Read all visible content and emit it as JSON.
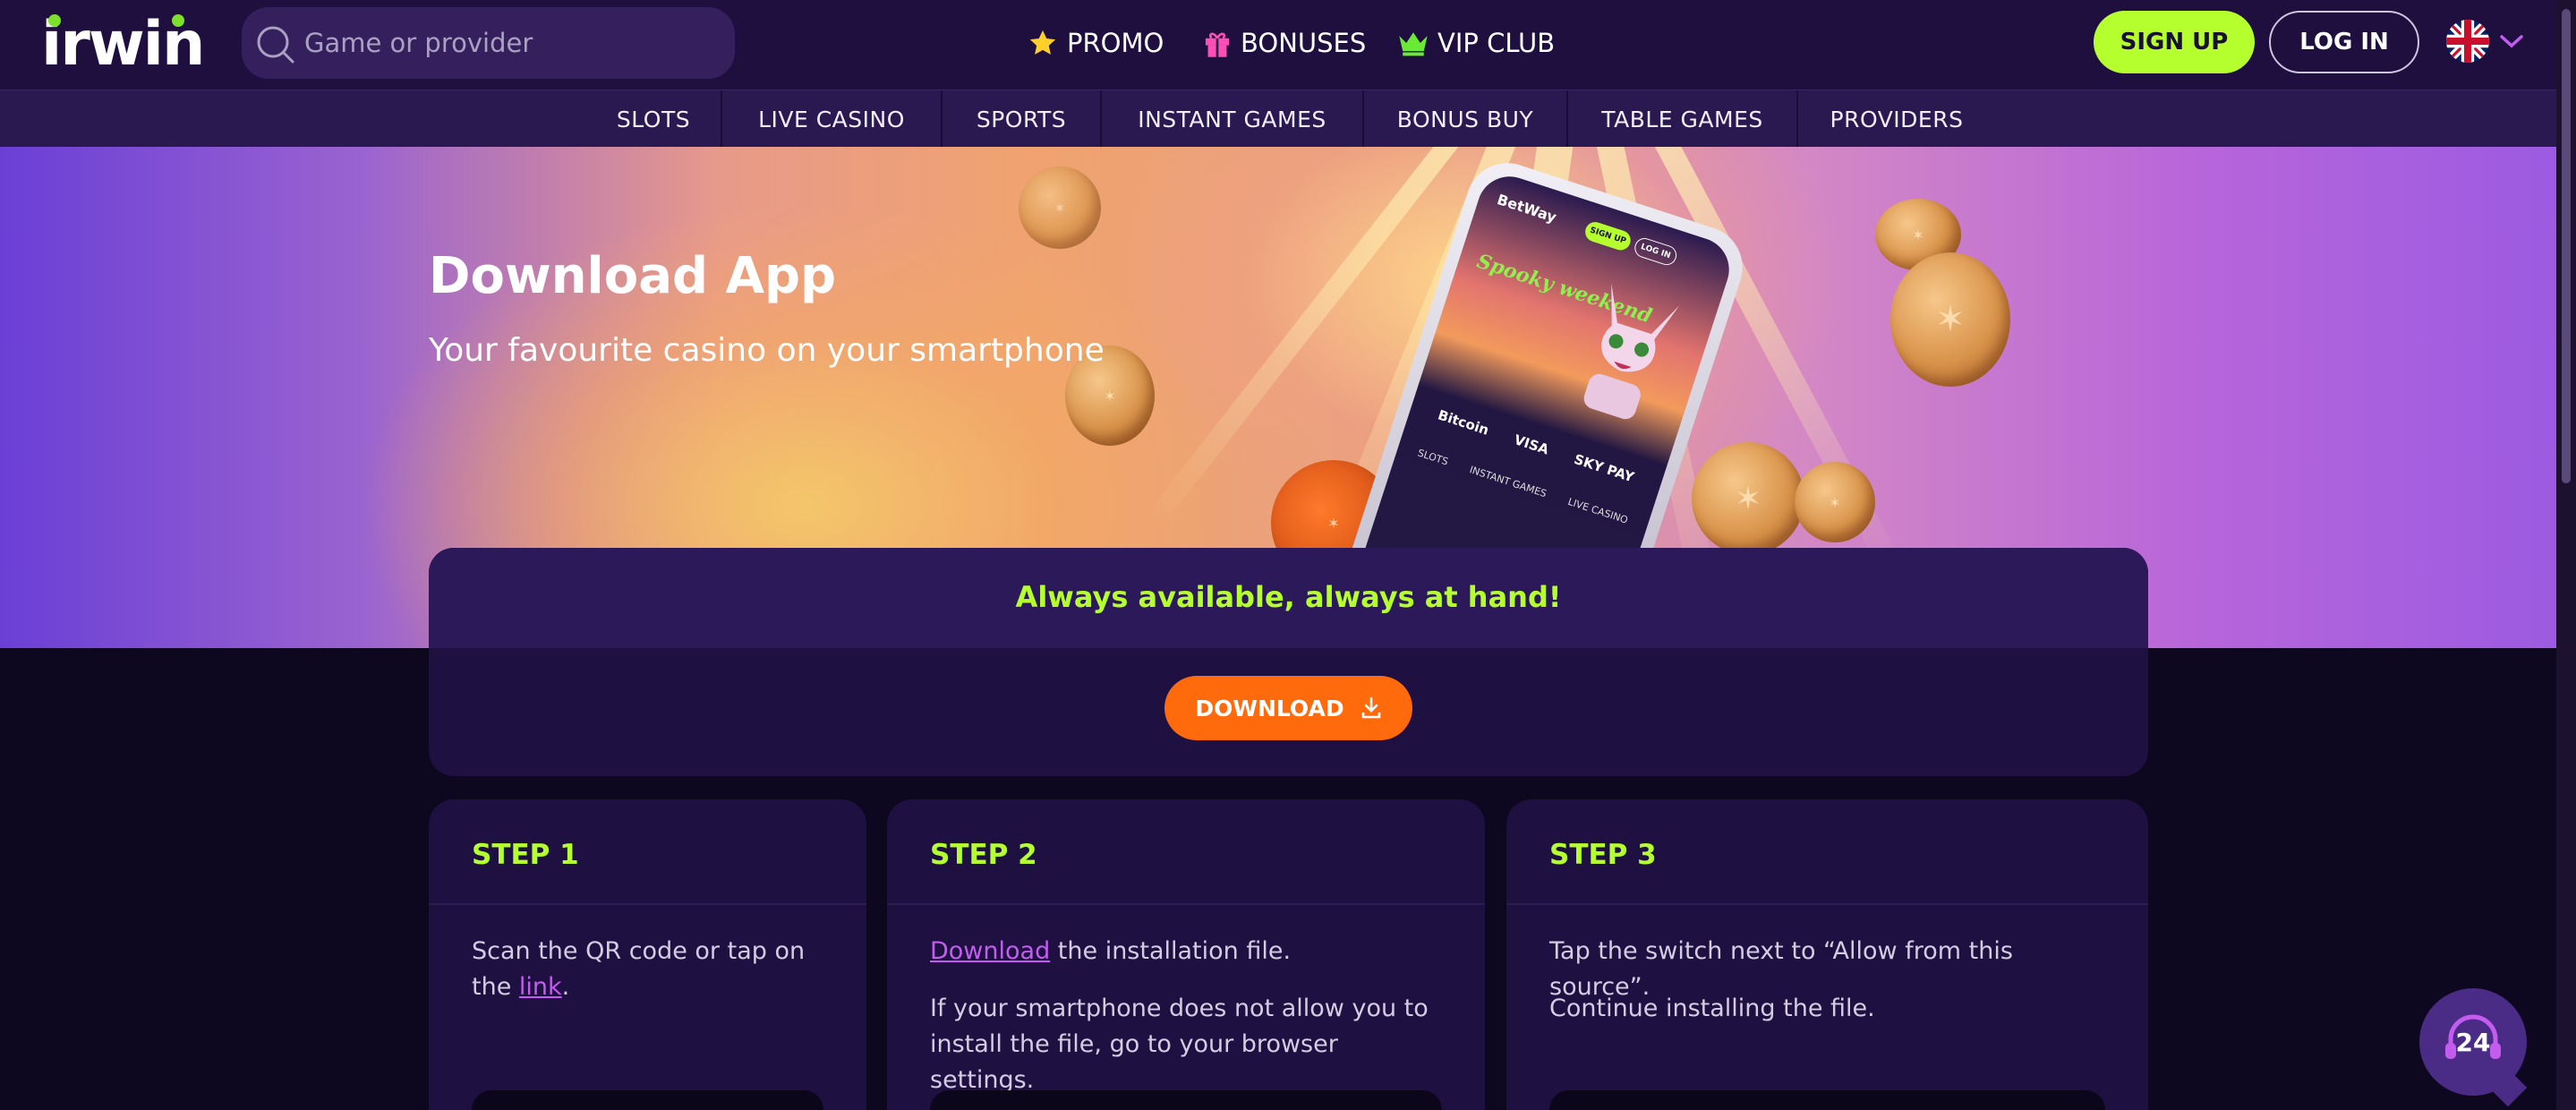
{
  "header": {
    "logo": "irwin",
    "search_placeholder": "Game or provider",
    "nav": [
      {
        "label": "PROMO",
        "icon": "star-icon"
      },
      {
        "label": "BONUSES",
        "icon": "gift-icon"
      },
      {
        "label": "VIP CLUB",
        "icon": "crown-icon"
      }
    ],
    "signup_label": "SIGN UP",
    "login_label": "LOG IN",
    "language_icon": "uk-flag-icon"
  },
  "categories": [
    "SLOTS",
    "LIVE CASINO",
    "SPORTS",
    "INSTANT GAMES",
    "BONUS BUY",
    "TABLE GAMES",
    "PROVIDERS"
  ],
  "hero": {
    "title": "Download App",
    "subtitle": "Your favourite casino on your smartphone",
    "phone": {
      "brand": "BetWay",
      "signup": "SIGN UP",
      "login": "LOG IN",
      "headline": "Spooky weekend",
      "payments": [
        "Bitcoin",
        "VISA",
        "SKY PAY"
      ],
      "tabs": [
        "SLOTS",
        "INSTANT GAMES",
        "LIVE CASINO"
      ]
    }
  },
  "availability": {
    "title": "Always available, always at hand!",
    "download_label": "DOWNLOAD"
  },
  "steps": [
    {
      "title": "STEP 1",
      "text_before": "Scan the QR code or tap on the ",
      "link": "link",
      "text_after": "."
    },
    {
      "title": "STEP 2",
      "link": "Download",
      "text_after": " the installation file.",
      "extra": "If your smartphone does not allow you to install the file, go to your browser settings."
    },
    {
      "title": "STEP 3",
      "text": "Tap the switch next to “Allow from this source”.",
      "extra": "Continue installing the file."
    }
  ],
  "support": {
    "label": "24"
  },
  "colors": {
    "accent_green": "#b6ff2e",
    "download_orange": "#ff6a0d",
    "link_purple": "#c45cf0",
    "bg": "#0e0720"
  }
}
